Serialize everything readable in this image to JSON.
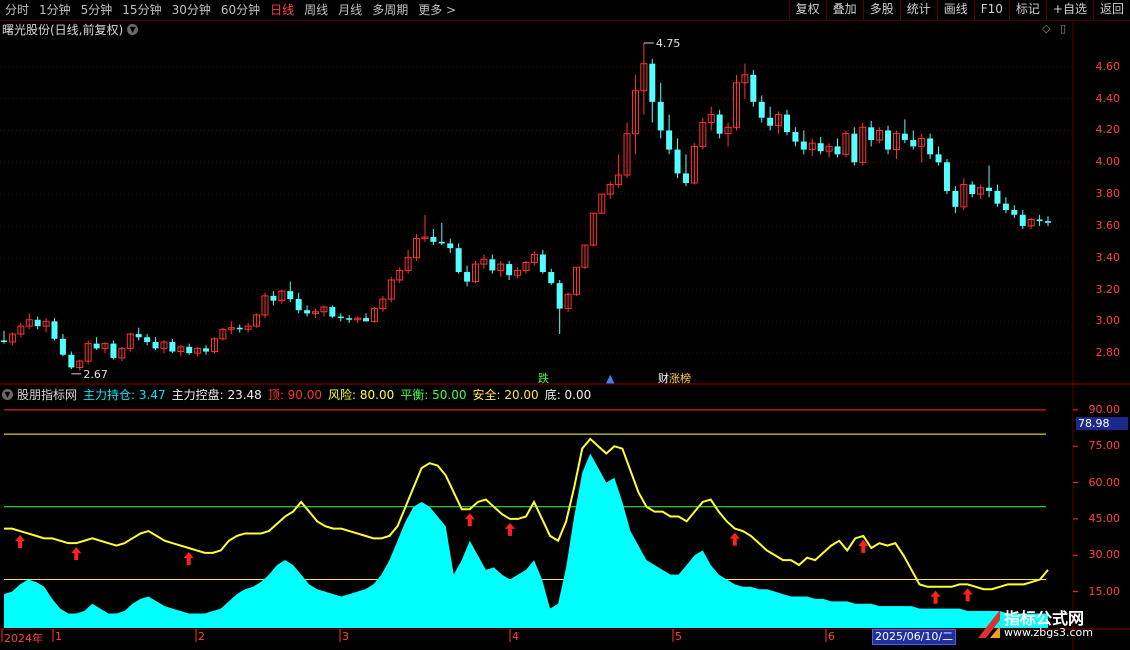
{
  "toolbar": {
    "tabs": [
      "分时",
      "1分钟",
      "5分钟",
      "15分钟",
      "30分钟",
      "60分钟",
      "日线",
      "周线",
      "月线",
      "多周期",
      "更多 >"
    ],
    "active_tab": "日线",
    "right_buttons": [
      "复权",
      "叠加",
      "多股",
      "统计",
      "画线",
      "F10",
      "标记",
      "+自选",
      "返回"
    ]
  },
  "chart_title": "曙光股份(日线,前复权)",
  "price_axis": [
    "4.60",
    "4.40",
    "4.20",
    "4.00",
    "3.80",
    "3.60",
    "3.40",
    "3.20",
    "3.00",
    "2.80"
  ],
  "annotations": {
    "high": "4.75",
    "low": "2.67"
  },
  "signals": {
    "die": "跌",
    "zhangbang": "涨榜",
    "zhangbang_prefix": "财"
  },
  "indicator": {
    "name": "股朋指标网",
    "items": [
      {
        "label": "主力持仓: 3.47",
        "color": "#00e5ff"
      },
      {
        "label": "主力控盘: 23.48",
        "color": "#f0f0f0"
      },
      {
        "label": "顶: 90.00",
        "color": "#ff3030"
      },
      {
        "label": "风险: 80.00",
        "color": "#ffff40"
      },
      {
        "label": "平衡: 50.00",
        "color": "#40ff40"
      },
      {
        "label": "安全: 20.00",
        "color": "#ffe050"
      },
      {
        "label": "底: 0.00",
        "color": "#f0f0f0"
      }
    ],
    "axis": [
      "90.00",
      "75.00",
      "60.00",
      "45.00",
      "30.00",
      "15.00"
    ],
    "current_value": "78.98"
  },
  "x_axis": {
    "labels": [
      "2024年",
      "1",
      "2",
      "3",
      "4",
      "5",
      "6"
    ],
    "cursor_date": "2025/06/10/二"
  },
  "watermark": {
    "title": "指标公式网",
    "url": "www.zbgs3.com"
  },
  "colors": {
    "up": "#ff3232",
    "down": "#54ffff",
    "grid": "#5a0000",
    "yellow": "#ffff30",
    "cyan": "#00ffff"
  },
  "candles_ohlc": [
    [
      2.88,
      2.94,
      2.86,
      2.87
    ],
    [
      2.87,
      2.93,
      2.85,
      2.92
    ],
    [
      2.92,
      2.99,
      2.9,
      2.97
    ],
    [
      2.97,
      3.05,
      2.95,
      3.01
    ],
    [
      3.01,
      3.03,
      2.95,
      2.97
    ],
    [
      2.97,
      3.02,
      2.93,
      3.0
    ],
    [
      3.0,
      3.02,
      2.88,
      2.89
    ],
    [
      2.89,
      2.92,
      2.78,
      2.79
    ],
    [
      2.79,
      2.81,
      2.7,
      2.71
    ],
    [
      2.71,
      2.76,
      2.69,
      2.75
    ],
    [
      2.75,
      2.88,
      2.73,
      2.86
    ],
    [
      2.86,
      2.9,
      2.82,
      2.83
    ],
    [
      2.83,
      2.87,
      2.8,
      2.86
    ],
    [
      2.86,
      2.88,
      2.76,
      2.77
    ],
    [
      2.77,
      2.84,
      2.75,
      2.83
    ],
    [
      2.83,
      2.93,
      2.81,
      2.92
    ],
    [
      2.92,
      2.96,
      2.88,
      2.9
    ],
    [
      2.9,
      2.92,
      2.85,
      2.87
    ],
    [
      2.87,
      2.9,
      2.82,
      2.83
    ],
    [
      2.83,
      2.88,
      2.8,
      2.87
    ],
    [
      2.87,
      2.89,
      2.8,
      2.81
    ],
    [
      2.81,
      2.85,
      2.78,
      2.84
    ],
    [
      2.84,
      2.86,
      2.79,
      2.8
    ],
    [
      2.8,
      2.84,
      2.78,
      2.83
    ],
    [
      2.83,
      2.85,
      2.79,
      2.81
    ],
    [
      2.81,
      2.9,
      2.8,
      2.89
    ],
    [
      2.89,
      2.96,
      2.88,
      2.95
    ],
    [
      2.95,
      3.0,
      2.92,
      2.96
    ],
    [
      2.96,
      2.98,
      2.93,
      2.95
    ],
    [
      2.95,
      2.99,
      2.93,
      2.97
    ],
    [
      2.97,
      3.05,
      2.96,
      3.04
    ],
    [
      3.04,
      3.18,
      3.02,
      3.16
    ],
    [
      3.16,
      3.19,
      3.1,
      3.13
    ],
    [
      3.13,
      3.2,
      3.11,
      3.19
    ],
    [
      3.19,
      3.25,
      3.12,
      3.14
    ],
    [
      3.14,
      3.18,
      3.05,
      3.07
    ],
    [
      3.07,
      3.1,
      3.03,
      3.05
    ],
    [
      3.05,
      3.08,
      3.02,
      3.06
    ],
    [
      3.06,
      3.1,
      3.03,
      3.09
    ],
    [
      3.09,
      3.1,
      3.02,
      3.03
    ],
    [
      3.03,
      3.05,
      3.0,
      3.02
    ],
    [
      3.02,
      3.04,
      2.99,
      3.01
    ],
    [
      3.01,
      3.03,
      2.99,
      3.02
    ],
    [
      3.02,
      3.05,
      3.0,
      3.0
    ],
    [
      3.0,
      3.09,
      2.99,
      3.08
    ],
    [
      3.08,
      3.16,
      3.06,
      3.14
    ],
    [
      3.14,
      3.28,
      3.12,
      3.26
    ],
    [
      3.26,
      3.34,
      3.24,
      3.32
    ],
    [
      3.32,
      3.45,
      3.3,
      3.4
    ],
    [
      3.4,
      3.55,
      3.38,
      3.52
    ],
    [
      3.52,
      3.67,
      3.5,
      3.53
    ],
    [
      3.53,
      3.58,
      3.48,
      3.5
    ],
    [
      3.5,
      3.62,
      3.48,
      3.49
    ],
    [
      3.49,
      3.52,
      3.43,
      3.46
    ],
    [
      3.46,
      3.49,
      3.3,
      3.31
    ],
    [
      3.31,
      3.35,
      3.22,
      3.25
    ],
    [
      3.25,
      3.38,
      3.24,
      3.36
    ],
    [
      3.36,
      3.42,
      3.33,
      3.39
    ],
    [
      3.39,
      3.42,
      3.3,
      3.32
    ],
    [
      3.32,
      3.38,
      3.28,
      3.36
    ],
    [
      3.36,
      3.38,
      3.26,
      3.29
    ],
    [
      3.29,
      3.34,
      3.27,
      3.32
    ],
    [
      3.32,
      3.38,
      3.3,
      3.37
    ],
    [
      3.37,
      3.44,
      3.35,
      3.42
    ],
    [
      3.42,
      3.45,
      3.3,
      3.31
    ],
    [
      3.31,
      3.33,
      3.23,
      3.24
    ],
    [
      3.24,
      3.26,
      2.92,
      3.08
    ],
    [
      3.08,
      3.18,
      3.06,
      3.17
    ],
    [
      3.17,
      3.34,
      3.16,
      3.34
    ],
    [
      3.34,
      3.48,
      3.33,
      3.48
    ],
    [
      3.48,
      3.68,
      3.47,
      3.68
    ],
    [
      3.68,
      3.8,
      3.68,
      3.8
    ],
    [
      3.8,
      3.88,
      3.77,
      3.86
    ],
    [
      3.86,
      4.05,
      3.84,
      3.92
    ],
    [
      3.92,
      4.25,
      3.9,
      4.18
    ],
    [
      4.18,
      4.55,
      4.05,
      4.45
    ],
    [
      4.45,
      4.75,
      4.3,
      4.62
    ],
    [
      4.62,
      4.65,
      4.25,
      4.38
    ],
    [
      4.38,
      4.5,
      4.15,
      4.2
    ],
    [
      4.2,
      4.3,
      4.05,
      4.08
    ],
    [
      4.08,
      4.15,
      3.9,
      3.93
    ],
    [
      3.93,
      4.05,
      3.85,
      3.87
    ],
    [
      3.87,
      4.12,
      3.86,
      4.1
    ],
    [
      4.1,
      4.28,
      4.08,
      4.25
    ],
    [
      4.25,
      4.35,
      4.2,
      4.3
    ],
    [
      4.3,
      4.33,
      4.15,
      4.18
    ],
    [
      4.18,
      4.25,
      4.1,
      4.22
    ],
    [
      4.22,
      4.55,
      4.2,
      4.5
    ],
    [
      4.5,
      4.62,
      4.4,
      4.55
    ],
    [
      4.55,
      4.58,
      4.35,
      4.38
    ],
    [
      4.38,
      4.42,
      4.25,
      4.28
    ],
    [
      4.28,
      4.35,
      4.2,
      4.23
    ],
    [
      4.23,
      4.32,
      4.18,
      4.3
    ],
    [
      4.3,
      4.33,
      4.17,
      4.19
    ],
    [
      4.19,
      4.22,
      4.1,
      4.13
    ],
    [
      4.13,
      4.2,
      4.05,
      4.08
    ],
    [
      4.08,
      4.15,
      4.04,
      4.12
    ],
    [
      4.12,
      4.16,
      4.05,
      4.07
    ],
    [
      4.07,
      4.12,
      4.03,
      4.1
    ],
    [
      4.1,
      4.15,
      4.03,
      4.05
    ],
    [
      4.05,
      4.2,
      4.03,
      4.18
    ],
    [
      4.18,
      4.22,
      3.98,
      4.0
    ],
    [
      4.0,
      4.25,
      3.98,
      4.22
    ],
    [
      4.22,
      4.26,
      4.1,
      4.14
    ],
    [
      4.14,
      4.22,
      4.12,
      4.2
    ],
    [
      4.2,
      4.23,
      4.05,
      4.08
    ],
    [
      4.08,
      4.2,
      4.02,
      4.18
    ],
    [
      4.18,
      4.27,
      4.12,
      4.14
    ],
    [
      4.14,
      4.2,
      4.08,
      4.1
    ],
    [
      4.1,
      4.18,
      4.0,
      4.15
    ],
    [
      4.15,
      4.18,
      4.02,
      4.05
    ],
    [
      4.05,
      4.1,
      3.98,
      4.0
    ],
    [
      4.0,
      4.02,
      3.8,
      3.82
    ],
    [
      3.82,
      3.85,
      3.68,
      3.72
    ],
    [
      3.72,
      3.9,
      3.7,
      3.86
    ],
    [
      3.86,
      3.88,
      3.78,
      3.8
    ],
    [
      3.8,
      3.86,
      3.77,
      3.84
    ],
    [
      3.84,
      3.98,
      3.78,
      3.82
    ],
    [
      3.82,
      3.86,
      3.72,
      3.74
    ],
    [
      3.74,
      3.78,
      3.68,
      3.7
    ],
    [
      3.7,
      3.73,
      3.65,
      3.67
    ],
    [
      3.67,
      3.7,
      3.58,
      3.6
    ],
    [
      3.6,
      3.65,
      3.58,
      3.64
    ],
    [
      3.64,
      3.67,
      3.6,
      3.63
    ],
    [
      3.63,
      3.66,
      3.6,
      3.62
    ]
  ],
  "indicator_series": {
    "control": [
      41,
      41,
      40,
      39,
      38,
      37,
      37,
      36,
      35,
      35,
      36,
      37,
      36,
      35,
      34,
      35,
      37,
      39,
      40,
      38,
      36,
      35,
      34,
      33,
      32,
      31,
      31,
      32,
      36,
      38,
      39,
      39,
      39,
      40,
      43,
      46,
      48,
      52,
      48,
      44,
      42,
      41,
      41,
      40,
      39,
      38,
      37,
      37,
      38,
      42,
      50,
      58,
      66,
      68,
      67,
      63,
      56,
      49,
      49,
      52,
      53,
      50,
      47,
      45,
      45,
      46,
      52,
      45,
      38,
      36,
      44,
      58,
      74,
      78,
      75,
      72,
      75,
      74,
      65,
      56,
      50,
      48,
      48,
      46,
      46,
      44,
      48,
      52,
      53,
      48,
      44,
      41,
      40,
      38,
      35,
      32,
      30,
      28,
      28,
      26,
      29,
      28,
      31,
      34,
      36,
      32,
      37,
      38,
      33,
      35,
      34,
      35,
      30,
      24,
      18,
      17,
      17,
      17,
      17,
      18,
      18,
      17,
      16,
      16,
      17,
      18,
      18,
      18,
      19,
      20,
      24
    ],
    "holding": [
      14,
      15,
      18,
      20,
      19,
      17,
      12,
      8,
      6,
      6,
      7,
      10,
      8,
      6,
      6,
      7,
      10,
      12,
      13,
      11,
      9,
      8,
      7,
      6,
      6,
      6,
      7,
      8,
      11,
      14,
      16,
      17,
      19,
      22,
      26,
      28,
      26,
      22,
      18,
      16,
      15,
      14,
      13,
      14,
      15,
      16,
      18,
      22,
      28,
      36,
      44,
      50,
      52,
      50,
      46,
      42,
      22,
      28,
      36,
      30,
      24,
      25,
      22,
      20,
      22,
      24,
      28,
      20,
      8,
      10,
      25,
      46,
      64,
      72,
      66,
      60,
      62,
      52,
      40,
      34,
      28,
      26,
      24,
      22,
      22,
      26,
      30,
      32,
      26,
      22,
      20,
      18,
      17,
      17,
      16,
      16,
      15,
      14,
      13,
      13,
      13,
      12,
      12,
      11,
      11,
      11,
      10,
      10,
      10,
      9,
      9,
      9,
      9,
      9,
      8,
      8,
      8,
      8,
      8,
      8,
      7,
      7,
      7,
      7,
      7,
      6,
      6,
      6,
      6,
      6,
      6
    ],
    "arrow_positions": [
      2,
      9,
      23,
      58,
      63,
      91,
      107,
      116,
      120
    ]
  }
}
